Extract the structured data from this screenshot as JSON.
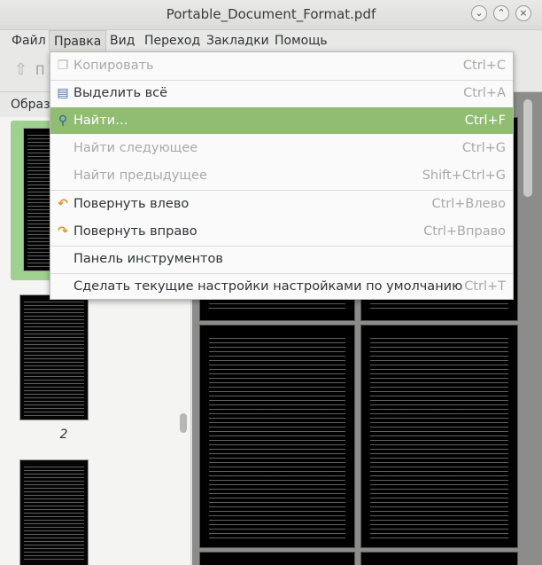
{
  "window": {
    "title": "Portable_Document_Format.pdf"
  },
  "window_controls": {
    "minimize": "⌄",
    "maximize": "⌃",
    "close": "×"
  },
  "menubar": {
    "items": [
      {
        "label": "Файл"
      },
      {
        "label": "Правка"
      },
      {
        "label": "Вид"
      },
      {
        "label": "Переход"
      },
      {
        "label": "Закладки"
      },
      {
        "label": "Помощь"
      }
    ]
  },
  "toolbar": {
    "back_label": "П"
  },
  "sidebar": {
    "header": "Образ",
    "page_number": "2"
  },
  "edit_menu": {
    "items": [
      {
        "label": "Копировать",
        "accel": "Ctrl+C",
        "icon": "copy-icon"
      },
      {
        "label": "Выделить всё",
        "accel": "Ctrl+A",
        "icon": "select-all-icon"
      },
      {
        "label": "Найти…",
        "accel": "Ctrl+F",
        "icon": "magnifier-icon"
      },
      {
        "label": "Найти следующее",
        "accel": "Ctrl+G"
      },
      {
        "label": "Найти предыдущее",
        "accel": "Shift+Ctrl+G"
      },
      {
        "label": "Повернуть влево",
        "accel": "Ctrl+Влево",
        "icon": "rotate-left-icon"
      },
      {
        "label": "Повернуть вправо",
        "accel": "Ctrl+Вправо",
        "icon": "rotate-right-icon"
      },
      {
        "label": "Панель инструментов",
        "accel": ""
      },
      {
        "label": "Сделать текущие настройки настройками по умолчанию",
        "accel": "Ctrl+T"
      }
    ]
  },
  "colors": {
    "highlight": "#91bd72",
    "thumb_selected": "#9ed08e"
  }
}
